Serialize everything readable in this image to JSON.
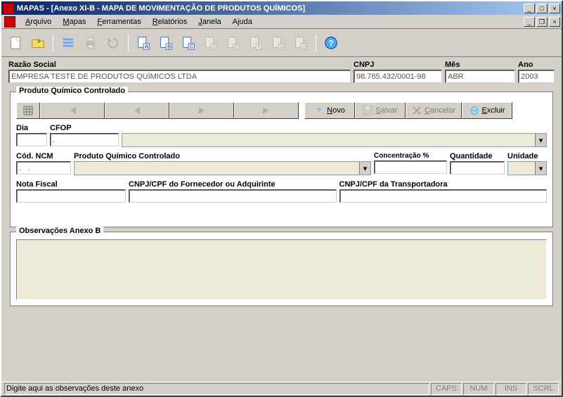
{
  "window": {
    "title": "MAPAS - [Anexo XI-B - MAPA DE MOVIMENTAÇÃO DE PRODUTOS QUÍMICOS]"
  },
  "menu": {
    "arquivo": "Arquivo",
    "mapas": "Mapas",
    "ferramentas": "Ferramentas",
    "relatorios": "Relatórios",
    "janela": "Janela",
    "ajuda": "Ajuda"
  },
  "toolbar_letters": {
    "a": "A",
    "b": "B",
    "c": "C",
    "d": "D",
    "e": "E",
    "f": "F",
    "g": "G",
    "h": "H"
  },
  "header": {
    "razao_label": "Razão Social",
    "razao_value": "EMPRESA TESTE DE PRODUTOS QUÍMICOS LTDA",
    "cnpj_label": "CNPJ",
    "cnpj_value": "98.765.432/0001-98",
    "mes_label": "Mês",
    "mes_value": "ABR",
    "ano_label": "Ano",
    "ano_value": "2003"
  },
  "group1": {
    "legend": "Produto Químico Controlado",
    "btn_novo": "Novo",
    "btn_salvar": "Salvar",
    "btn_cancelar": "Cancelar",
    "btn_excluir": "Excluir",
    "dia_label": "Dia",
    "dia_value": "",
    "cfop_label": "CFOP",
    "cfop_code": ".",
    "cfop_desc": "",
    "cod_ncm_label": "Cód. NCM",
    "cod_ncm_value": ".   .",
    "produto_label": "Produto Químico Controlado",
    "produto_value": "",
    "concentracao_label": "Concentração %",
    "concentracao_value": "",
    "quantidade_label": "Quantidade",
    "quantidade_value": "",
    "unidade_label": "Unidade",
    "unidade_value": "",
    "nota_label": "Nota Fiscal",
    "nota_value": "",
    "cnpj_forn_label": "CNPJ/CPF do Fornecedor ou Adquirinte",
    "cnpj_forn_value": "",
    "cnpj_transp_label": "CNPJ/CPF da Transportadora",
    "cnpj_transp_value": ""
  },
  "group2": {
    "legend": "Observações Anexo B"
  },
  "status": {
    "msg": "Digite aqui as observações deste anexo",
    "caps": "CAPS",
    "num": "NUM",
    "ins": "INS",
    "scrl": "SCRL"
  }
}
